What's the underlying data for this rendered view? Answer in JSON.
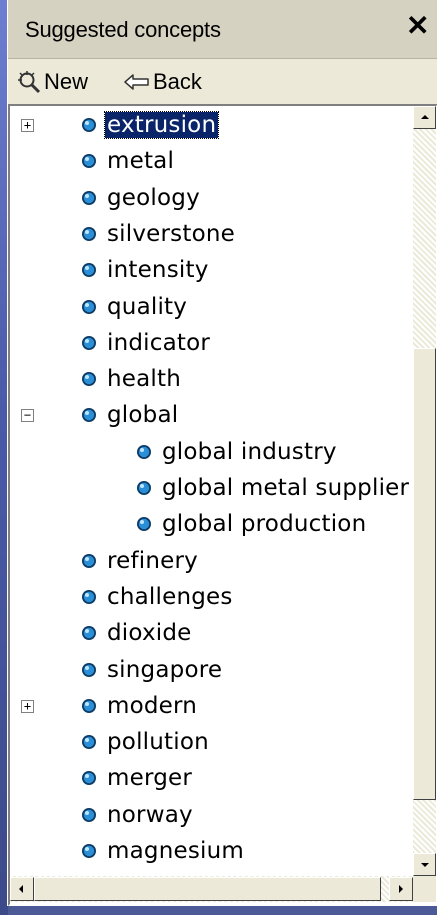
{
  "panel": {
    "title": "Suggested concepts",
    "close_symbol": "✕"
  },
  "toolbar": {
    "new_label": "New",
    "new_icon": "magic-wand-icon",
    "back_label": "Back",
    "back_icon": "back-arrow-icon"
  },
  "tree": {
    "items": [
      {
        "label": "extrusion",
        "expander": "+",
        "selected": true
      },
      {
        "label": "metal"
      },
      {
        "label": "geology"
      },
      {
        "label": "silverstone"
      },
      {
        "label": "intensity"
      },
      {
        "label": "quality"
      },
      {
        "label": "indicator"
      },
      {
        "label": "health"
      },
      {
        "label": "global",
        "expander": "−"
      },
      {
        "label": "global industry",
        "child": true
      },
      {
        "label": "global metal supplier",
        "child": true
      },
      {
        "label": "global production",
        "child": true
      },
      {
        "label": "refinery"
      },
      {
        "label": "challenges"
      },
      {
        "label": "dioxide"
      },
      {
        "label": "singapore"
      },
      {
        "label": "modern",
        "expander": "+"
      },
      {
        "label": "pollution"
      },
      {
        "label": "merger"
      },
      {
        "label": "norway"
      },
      {
        "label": "magnesium"
      }
    ]
  },
  "colors": {
    "selection": "#0a246a",
    "bullet": "#1a6fb5",
    "panel": "#ece9d8"
  }
}
